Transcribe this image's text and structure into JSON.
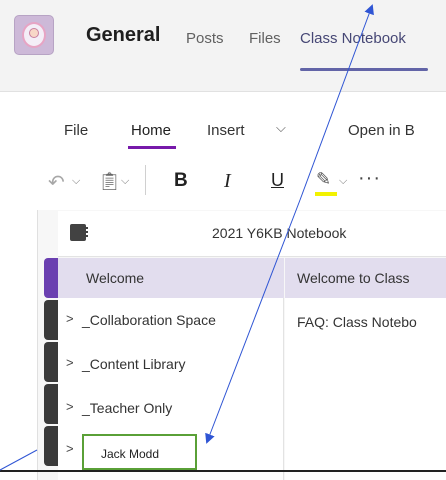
{
  "header": {
    "team_name": "General",
    "tabs": [
      {
        "label": "Posts"
      },
      {
        "label": "Files"
      },
      {
        "label": "Class Notebook",
        "active": true
      }
    ]
  },
  "ribbon": {
    "menu": [
      {
        "label": "File"
      },
      {
        "label": "Home",
        "active": true
      },
      {
        "label": "Insert"
      },
      {
        "label": "Open in B"
      }
    ],
    "tools": {
      "bold": "B",
      "italic": "I",
      "underline": "U",
      "more": "···"
    },
    "highlight_color": "#f2f200"
  },
  "notebook": {
    "title": "2021 Y6KB Notebook",
    "sections": [
      {
        "label": "Welcome",
        "selected": true
      },
      {
        "label": "_Collaboration Space"
      },
      {
        "label": "_Content Library"
      },
      {
        "label": "_Teacher Only"
      },
      {
        "label": "Jack Modd"
      }
    ],
    "pages": [
      {
        "label": "Welcome to Class",
        "selected": true
      },
      {
        "label": "FAQ: Class Notebo"
      }
    ]
  },
  "annotation": {
    "arrow_color": "#2f55d4",
    "box_color": "#5aa037"
  }
}
